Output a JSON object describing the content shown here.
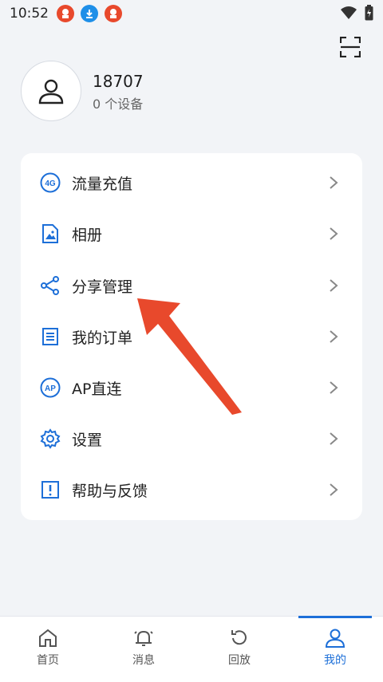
{
  "status_bar": {
    "time": "10:52"
  },
  "profile": {
    "name": "18707",
    "devices": "0 个设备"
  },
  "menu": [
    {
      "label": "流量充值",
      "icon": "4g-icon"
    },
    {
      "label": "相册",
      "icon": "album-icon"
    },
    {
      "label": "分享管理",
      "icon": "share-icon"
    },
    {
      "label": "我的订单",
      "icon": "order-icon"
    },
    {
      "label": "AP直连",
      "icon": "ap-icon"
    },
    {
      "label": "设置",
      "icon": "gear-icon"
    },
    {
      "label": "帮助与反馈",
      "icon": "help-icon"
    }
  ],
  "tabs": [
    {
      "label": "首页",
      "icon": "home-icon"
    },
    {
      "label": "消息",
      "icon": "bell-icon"
    },
    {
      "label": "回放",
      "icon": "replay-icon"
    },
    {
      "label": "我的",
      "icon": "person-icon"
    }
  ],
  "colors": {
    "accent": "#1d6fd8",
    "annotation": "#e8492c"
  },
  "icon_labels": {
    "four_g": "4G",
    "ap": "AP"
  }
}
